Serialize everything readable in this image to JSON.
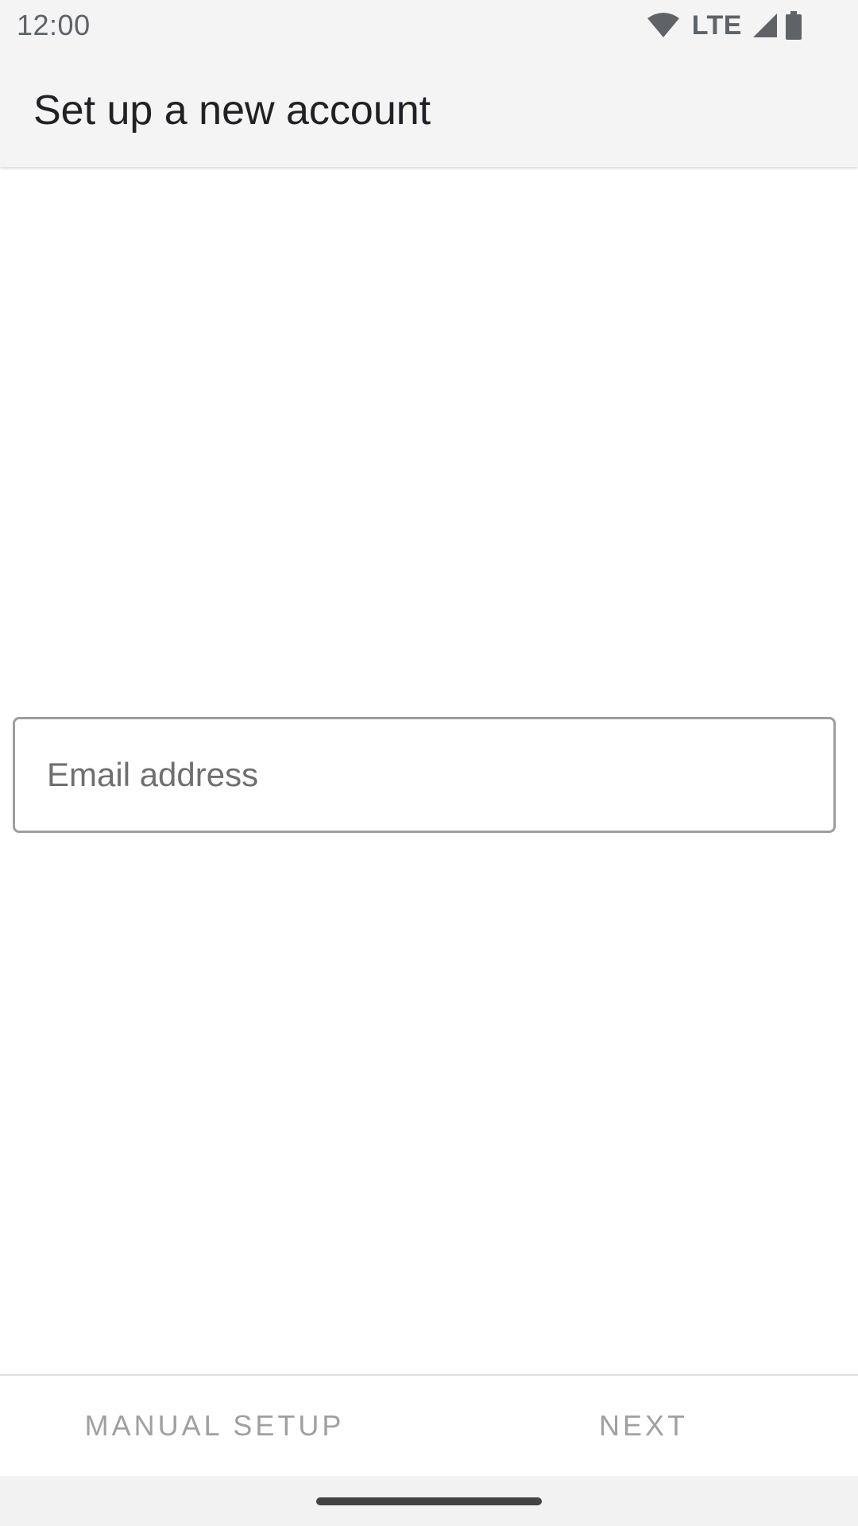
{
  "status_bar": {
    "time": "12:00",
    "network_label": "LTE",
    "icons": [
      "wifi-icon",
      "cell-signal-icon",
      "battery-icon"
    ]
  },
  "app_bar": {
    "title": "Set up a new account"
  },
  "form": {
    "email": {
      "value": "",
      "placeholder": "Email address"
    }
  },
  "actions": {
    "manual_setup_label": "MANUAL SETUP",
    "next_label": "NEXT"
  },
  "colors": {
    "status_bar_bg": "#f4f4f4",
    "app_bar_bg": "#f4f4f4",
    "field_border": "#9e9e9e",
    "button_text_disabled": "#a0a0a0"
  }
}
